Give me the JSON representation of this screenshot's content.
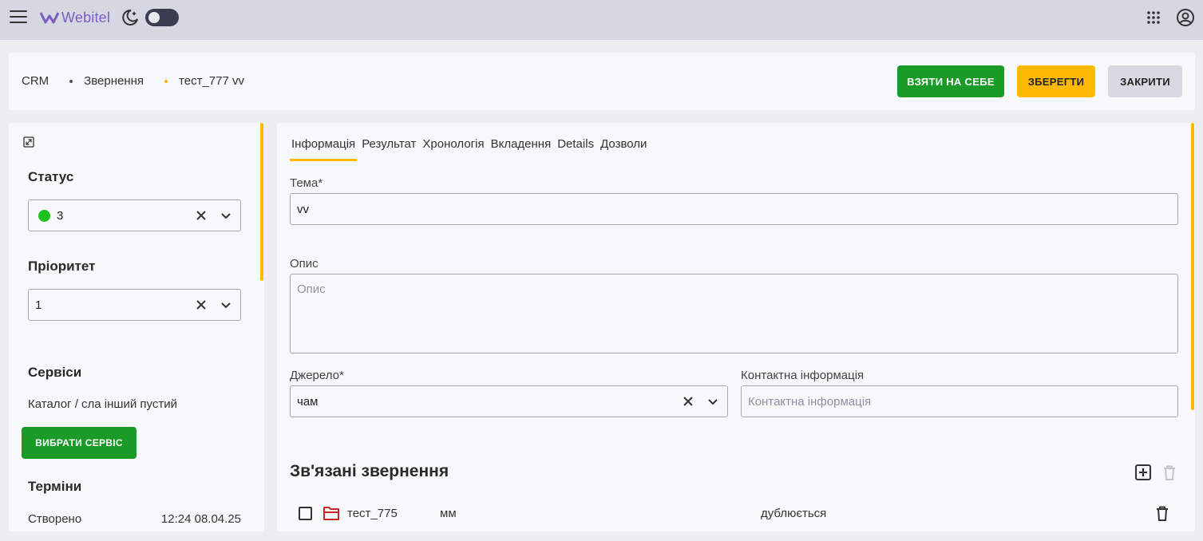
{
  "topbar": {
    "logo_text": "Webitel",
    "icons": [
      "menu-icon",
      "moon-icon",
      "apps-grid-icon",
      "user-circle-icon"
    ],
    "theme_toggle": "off"
  },
  "breadcrumb": {
    "items": [
      "CRM",
      "Звернення",
      "тест_777 vv"
    ]
  },
  "header": {
    "take_label": "ВЗЯТИ НА СЕБЕ",
    "save_label": "ЗБЕРЕГТИ",
    "close_label": "ЗАКРИТИ"
  },
  "sidebar": {
    "status_title": "Статус",
    "status_value": "3",
    "priority_title": "Пріоритет",
    "priority_value": "1",
    "services_title": "Сервіси",
    "services_text": "Каталог / сла інший пустий",
    "choose_service_label": "ВИБРАТИ СЕРВІС",
    "terms_title": "Терміни",
    "created_label": "Створено",
    "created_value": "12:24 08.04.25"
  },
  "tabs": [
    "Інформація",
    "Результат",
    "Хронологія",
    "Вкладення",
    "Details",
    "Дозволи"
  ],
  "form": {
    "subject_label": "Тема*",
    "subject_value": "vv",
    "description_label": "Опис",
    "description_placeholder": "Опис",
    "source_label": "Джерело*",
    "source_value": "чам",
    "contact_label": "Контактна інформація",
    "contact_placeholder": "Контактна інформація"
  },
  "related": {
    "title": "Зв'язані звернення",
    "rows": [
      {
        "name": "тест_775",
        "subject": "мм",
        "relation": "дублюється"
      }
    ]
  },
  "colors": {
    "accent_yellow": "#ffb900",
    "green": "#1a9a26",
    "status_dot": "#1fbf20",
    "logo_purple": "#7b5cc4"
  }
}
